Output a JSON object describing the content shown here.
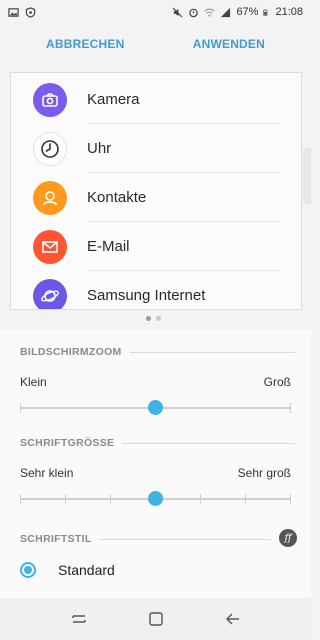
{
  "status_bar": {
    "battery": "67%",
    "time": "21:08",
    "icons": [
      "picture-icon",
      "shield-icon",
      "mute-icon",
      "alarm-icon",
      "wifi-icon",
      "signal-icon",
      "battery-icon"
    ]
  },
  "action_bar": {
    "cancel_label": "ABBRECHEN",
    "apply_label": "ANWENDEN"
  },
  "preview": {
    "apps": [
      {
        "label": "Kamera",
        "icon": "camera-icon",
        "color": "#7a5cf0"
      },
      {
        "label": "Uhr",
        "icon": "clock-icon",
        "color": "#ffffff"
      },
      {
        "label": "Kontakte",
        "icon": "contact-icon",
        "color": "#ff9a1f"
      },
      {
        "label": "E-Mail",
        "icon": "mail-icon",
        "color": "#ff5533"
      },
      {
        "label": "Samsung Internet",
        "icon": "planet-icon",
        "color": "#6b57e8"
      }
    ],
    "page_count": 2,
    "active_page": 1
  },
  "screen_zoom": {
    "heading": "BILDSCHIRMZOOM",
    "min_label": "Klein",
    "max_label": "Groß",
    "steps": 2,
    "value": 1
  },
  "font_size": {
    "heading": "SCHRIFTGRÖSSE",
    "min_label": "Sehr klein",
    "max_label": "Sehr groß",
    "steps": 6,
    "value": 3
  },
  "font_style": {
    "heading": "SCHRIFTSTIL",
    "selected_option": "Standard"
  },
  "colors": {
    "accent": "#3db3e6",
    "action_text": "#3f9bd1"
  }
}
